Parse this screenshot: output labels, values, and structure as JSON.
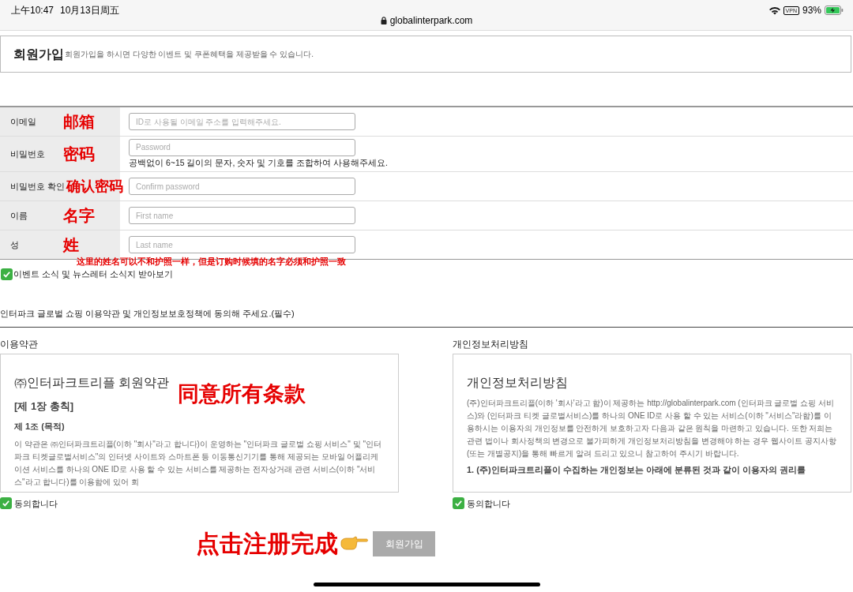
{
  "status_bar": {
    "time": "上午10:47",
    "date": "10月13日周五",
    "url": "globalinterpark.com",
    "vpn": "VPN",
    "battery": "93%"
  },
  "header": {
    "title": "회원가입",
    "subtitle": "회원가입을 하시면 다양한 이벤트 및 쿠폰혜택을 제공받을 수 있습니다."
  },
  "form": {
    "rows": [
      {
        "label": "이메일",
        "annotation": "邮箱",
        "placeholder": "ID로 사용될 이메일 주소를 입력해주세요."
      },
      {
        "label": "비밀번호",
        "annotation": "密码",
        "placeholder": "Password",
        "hint": "공백없이 6~15 길이의 문자, 숫자 및 기호를 조합하여 사용해주세요."
      },
      {
        "label": "비밀번호 확인",
        "annotation": "确认密码",
        "placeholder": "Confirm password"
      },
      {
        "label": "이름",
        "annotation": "名字",
        "placeholder": "First name"
      },
      {
        "label": "성",
        "annotation": "姓",
        "placeholder": "Last name"
      }
    ],
    "note_annotation": "这里的姓名可以不和护照一样，但是订购时候填的名字必须和护照一致"
  },
  "newsletter": {
    "label": "이벤트 소식 및 뉴스레터 소식지 받아보기",
    "checked": true
  },
  "agreement": {
    "title": "인터파크 글로벌 쇼핑 이용약관 및 개인정보보호정책에 동의해 주세요.(필수)",
    "annotation": "同意所有条款",
    "panels": [
      {
        "heading": "이용약관",
        "doc_title": "㈜인터파크트리플 회원약관",
        "chapter": "[제 1장 총칙]",
        "article": "제 1조 (목적)",
        "body": "이 약관은 ㈜인터파크트리플(이하 \"회사\"라고 합니다)이 운영하는 \"인터파크 글로벌 쇼핑 서비스\" 및 \"인터파크 티켓글로벌서비스\"의 인터넷 사이트와 스마트폰 등 이동통신기기를 통해 제공되는 모바일 어플리케이션 서비스를 하나의 ONE ID로 사용 할 수 있는 서비스를 제공하는 전자상거래 관련 서비스(이하 \"서비스\"라고 합니다)를 이용함에 있어 회",
        "agree": "동의합니다",
        "checked": true
      },
      {
        "heading": "개인정보처리방침",
        "doc_title": "개인정보처리방침",
        "body": "(주)인터파크트리플(이하 '회사'라고 함)이 제공하는 http://globalinterpark.com (인터파크 글로벌 쇼핑 서비스)와 (인터파크 티켓 글로벌서비스)를 하나의 ONE ID로 사용 할 수 있는 서비스(이하 \"서비스\"라함)를 이용하시는 이용자의 개인정보를 안전하게 보호하고자 다음과 같은 원칙을 마련하고 있습니다. 또한 저희는 관련 법이나 회사정책의 변경으로 불가피하게 개인정보처리방침을 변경해야 하는 경우 웹사이트 공지사항 (또는 개별공지)을 통해 빠르게 알려 드리고 있으니 참고하여 주시기 바랍니다.",
        "section": "1. (주)인터파크트리플이 수집하는 개인정보는 아래에 분류된 것과 같이 이용자의 권리를",
        "agree": "동의합니다",
        "checked": true
      }
    ]
  },
  "submit": {
    "annotation": "点击注册完成",
    "label": "회원가입"
  }
}
